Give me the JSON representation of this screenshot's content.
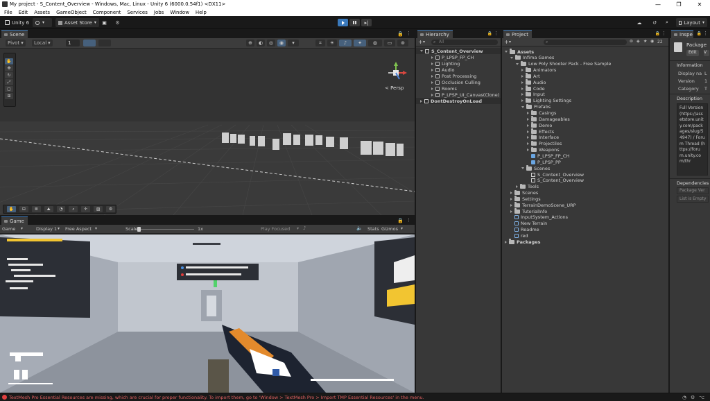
{
  "window": {
    "title": "My project - S_Content_Overview - Windows, Mac, Linux - Unity 6 (6000.0.54f1) <DX11>",
    "controls": [
      "—",
      "❐",
      "✕"
    ]
  },
  "menu": [
    "File",
    "Edit",
    "Assets",
    "GameObject",
    "Component",
    "Services",
    "Jobs",
    "Window",
    "Help"
  ],
  "toolbar": {
    "unity_label": "Unity 6",
    "asset_store": "Asset Store",
    "layout": "Layout"
  },
  "scene": {
    "tab": "Scene",
    "pivot": "Pivot",
    "local": "Local",
    "snap_value": "1",
    "persp": "< Persp"
  },
  "game": {
    "tab": "Game",
    "mode": "Game",
    "display": "Display 1",
    "aspect": "Free Aspect",
    "scale_label": "Scale",
    "scale_value": "1x",
    "play_focused": "Play Focused",
    "stats": "Stats",
    "gizmos": "Gizmos"
  },
  "hierarchy": {
    "tab": "Hierarchy",
    "search_placeholder": "All",
    "items": [
      {
        "label": "S_Content_Overview",
        "depth": 0,
        "kind": "scene",
        "open": true
      },
      {
        "label": "P_LPSP_FP_CH",
        "depth": 1,
        "kind": "cube"
      },
      {
        "label": "Lighting",
        "depth": 1,
        "kind": "cube"
      },
      {
        "label": "Audio",
        "depth": 1,
        "kind": "cube"
      },
      {
        "label": "Post Processing",
        "depth": 1,
        "kind": "cube"
      },
      {
        "label": "Occlusion Culling",
        "depth": 1,
        "kind": "cube"
      },
      {
        "label": "Rooms",
        "depth": 1,
        "kind": "cube"
      },
      {
        "label": "P_LPSP_UI_Canvas(Clone)",
        "depth": 1,
        "kind": "cube"
      },
      {
        "label": "DontDestroyOnLoad",
        "depth": 0,
        "kind": "scene",
        "open": false
      }
    ]
  },
  "project": {
    "tab": "Project",
    "badge": "22",
    "items": [
      {
        "label": "Assets",
        "depth": 0,
        "kind": "folder",
        "open": true
      },
      {
        "label": "Infima Games",
        "depth": 1,
        "kind": "folder",
        "open": true
      },
      {
        "label": "Low Poly Shooter Pack - Free Sample",
        "depth": 2,
        "kind": "folder",
        "open": true
      },
      {
        "label": "Animators",
        "depth": 3,
        "kind": "folder"
      },
      {
        "label": "Art",
        "depth": 3,
        "kind": "folder"
      },
      {
        "label": "Audio",
        "depth": 3,
        "kind": "folder"
      },
      {
        "label": "Code",
        "depth": 3,
        "kind": "folder"
      },
      {
        "label": "Input",
        "depth": 3,
        "kind": "folder"
      },
      {
        "label": "Lighting Settings",
        "depth": 3,
        "kind": "folder"
      },
      {
        "label": "Prefabs",
        "depth": 3,
        "kind": "folder",
        "open": true
      },
      {
        "label": "Casings",
        "depth": 4,
        "kind": "folder"
      },
      {
        "label": "Damageables",
        "depth": 4,
        "kind": "folder"
      },
      {
        "label": "Demo",
        "depth": 4,
        "kind": "folder"
      },
      {
        "label": "Effects",
        "depth": 4,
        "kind": "folder"
      },
      {
        "label": "Interface",
        "depth": 4,
        "kind": "folder"
      },
      {
        "label": "Projectiles",
        "depth": 4,
        "kind": "folder"
      },
      {
        "label": "Weapons",
        "depth": 4,
        "kind": "folder"
      },
      {
        "label": "P_LPSP_FP_CH",
        "depth": 4,
        "kind": "prefab"
      },
      {
        "label": "P_LPSP_PP",
        "depth": 4,
        "kind": "prefab"
      },
      {
        "label": "Scenes",
        "depth": 3,
        "kind": "folder",
        "open": true
      },
      {
        "label": "S_Content_Overview",
        "depth": 4,
        "kind": "scene"
      },
      {
        "label": "S_Content_Overview",
        "depth": 4,
        "kind": "scene"
      },
      {
        "label": "Tools",
        "depth": 2,
        "kind": "folder"
      },
      {
        "label": "Scenes",
        "depth": 1,
        "kind": "folder"
      },
      {
        "label": "Settings",
        "depth": 1,
        "kind": "folder"
      },
      {
        "label": "TerrainDemoScene_URP",
        "depth": 1,
        "kind": "folder"
      },
      {
        "label": "TutorialInfo",
        "depth": 1,
        "kind": "folder"
      },
      {
        "label": "InputSystem_Actions",
        "depth": 1,
        "kind": "asset"
      },
      {
        "label": "New Terrain",
        "depth": 1,
        "kind": "asset"
      },
      {
        "label": "Readme",
        "depth": 1,
        "kind": "asset"
      },
      {
        "label": "red",
        "depth": 1,
        "kind": "asset"
      },
      {
        "label": "Packages",
        "depth": 0,
        "kind": "folder"
      }
    ]
  },
  "inspector": {
    "tab": "Inspe",
    "title": "Package",
    "edit": "Edit",
    "information": "Information",
    "fields": [
      {
        "label": "Display na",
        "value": "L"
      },
      {
        "label": "Version",
        "value": "1"
      },
      {
        "label": "Category",
        "value": "T"
      }
    ],
    "description_header": "Description",
    "description": "Full Version (https://assetstore.unity.com/packages/slug/54947) / Forum Thread (https://forum.unity.com/thr",
    "dependencies": "Dependencies",
    "package_ver": "Package Ver",
    "list_empty": "List is Empty"
  },
  "status": {
    "message": "TextMesh Pro Essential Resources are missing, which are crucial for proper functionality. To import them, go to 'Window > TextMesh Pro > Import TMP Essential Resources' in the menu."
  },
  "colors": {
    "accent": "#3a79bb",
    "error": "#e04040",
    "panel": "#383838",
    "dark": "#191919"
  }
}
